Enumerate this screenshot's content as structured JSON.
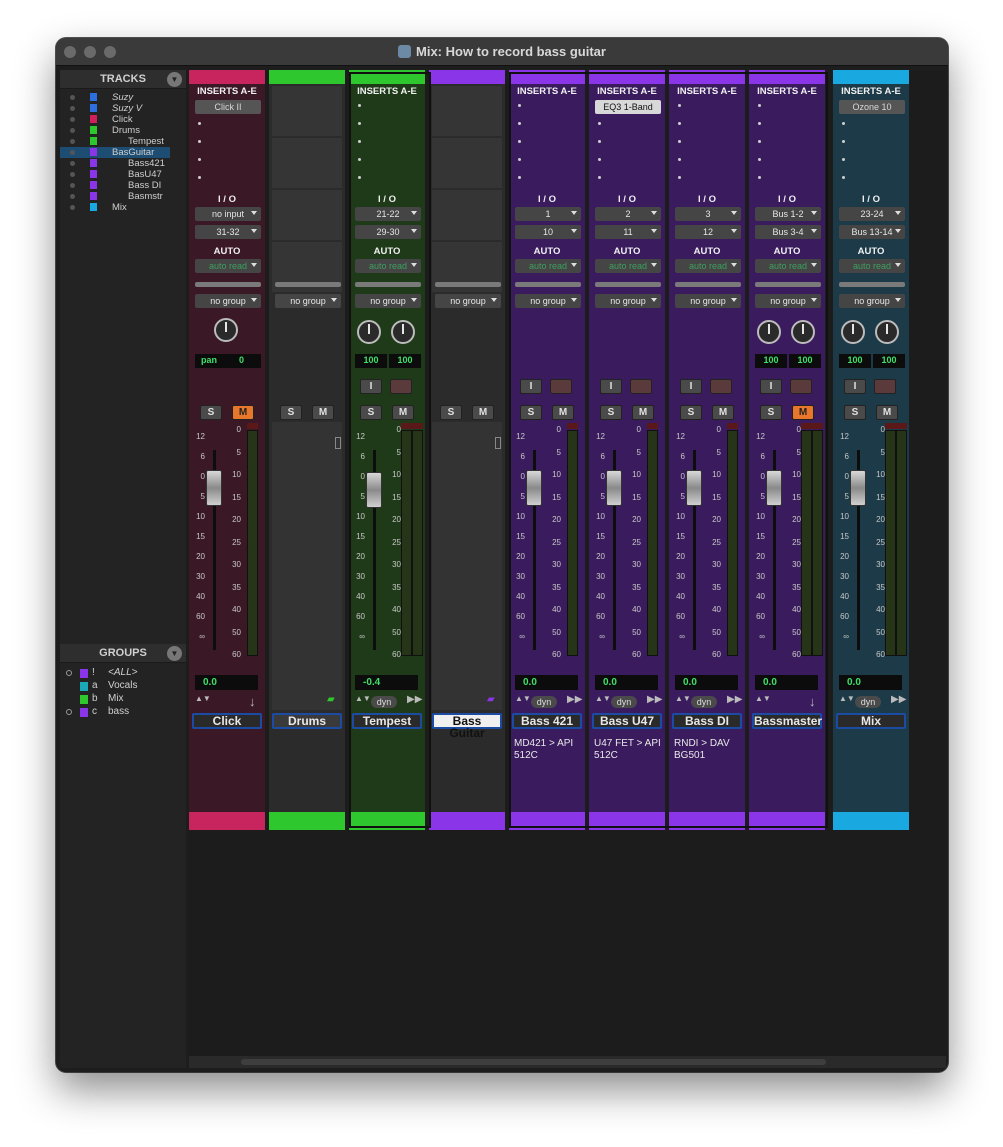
{
  "window": {
    "title": "Mix: How to record bass guitar"
  },
  "tracks_panel": {
    "header": "TRACKS",
    "items": [
      {
        "name": "Suzy",
        "color": "#2e6fe0",
        "italic": true
      },
      {
        "name": "Suzy V",
        "color": "#2e6fe0",
        "italic": true
      },
      {
        "name": "Click",
        "color": "#d0205a"
      },
      {
        "name": "Drums",
        "color": "#2ec82e"
      },
      {
        "name": "Tempest",
        "color": "#2ec82e"
      },
      {
        "name": "BasGuitar",
        "color": "#8a36e8",
        "selected": true
      },
      {
        "name": "Bass421",
        "color": "#8a36e8"
      },
      {
        "name": "BasU47",
        "color": "#8a36e8"
      },
      {
        "name": "Bass DI",
        "color": "#8a36e8"
      },
      {
        "name": "Basmstr",
        "color": "#8a36e8"
      },
      {
        "name": "Mix",
        "color": "#1aa8e0"
      }
    ]
  },
  "groups_panel": {
    "header": "GROUPS",
    "items": [
      {
        "key": "!",
        "name": "<ALL>",
        "color": "#8a36e8"
      },
      {
        "key": "a",
        "name": "Vocals",
        "color": "#1aa8b8"
      },
      {
        "key": "b",
        "name": "Mix",
        "color": "#2ec82e"
      },
      {
        "key": "c",
        "name": "bass",
        "color": "#8a36e8"
      }
    ]
  },
  "labels": {
    "inserts": "INSERTS A-E",
    "io": "I / O",
    "auto": "AUTO",
    "no_group": "no group",
    "auto_read": "auto read",
    "solo": "S",
    "mute": "M",
    "input": "I",
    "dyn": "dyn",
    "pan": "pan"
  },
  "scale_left": [
    "12",
    "6",
    "0",
    "5",
    "10",
    "15",
    "20",
    "30",
    "40",
    "60",
    "∞"
  ],
  "scale_right": [
    "0",
    "5",
    "10",
    "15",
    "20",
    "25",
    "30",
    "35",
    "40",
    "50",
    "60"
  ],
  "strips": [
    {
      "name": "Click",
      "color": "#c8245e",
      "body": "#3a1826",
      "type": "audio",
      "insert": "Click II",
      "input": "no input",
      "output": "31-32",
      "pan_value": "0",
      "volume": "0.0",
      "mute_on": true,
      "comment": ""
    },
    {
      "name": "Drums",
      "color": "#2ec82e",
      "body": "#2b2b2b",
      "type": "folder",
      "comment": ""
    },
    {
      "name": "Tempest",
      "color": "#2ec82e",
      "body": "#1f3a18",
      "type": "stereo",
      "insert": "",
      "input": "21-22",
      "output": "29-30",
      "pan_l": "100",
      "pan_r": "100",
      "volume": "-0.4",
      "mute_on": false,
      "comment": ""
    },
    {
      "name": "Bass Guitar",
      "color": "#8a36e8",
      "body": "#2b2b2b",
      "type": "folder",
      "comment": ""
    },
    {
      "name": "Bass 421",
      "color": "#8a36e8",
      "body": "#3a1c5e",
      "type": "mono",
      "insert": "",
      "input": "1",
      "output": "10",
      "volume": "0.0",
      "mute_on": false,
      "comment": "MD421 > API 512C"
    },
    {
      "name": "Bass U47",
      "color": "#8a36e8",
      "body": "#3a1c5e",
      "type": "mono",
      "insert": "EQ3 1-Band",
      "input": "2",
      "output": "11",
      "volume": "0.0",
      "mute_on": false,
      "comment": "U47 FET  >  API 512C"
    },
    {
      "name": "Bass DI",
      "color": "#8a36e8",
      "body": "#3a1c5e",
      "type": "mono",
      "insert": "",
      "input": "3",
      "output": "12",
      "volume": "0.0",
      "mute_on": false,
      "comment": "RNDI  >  DAV BG501"
    },
    {
      "name": "Bassmaster",
      "color": "#8a36e8",
      "body": "#3a1c5e",
      "type": "aux",
      "insert": "",
      "input": "Bus 1-2",
      "output": "Bus 3-4",
      "pan_l": "100",
      "pan_r": "100",
      "volume": "0.0",
      "mute_on": true,
      "comment": ""
    },
    {
      "name": "Mix",
      "color": "#1aa8e0",
      "body": "#1c3a48",
      "type": "stereo",
      "insert": "Ozone 10",
      "input": "23-24",
      "output": "Bus 13-14",
      "pan_l": "100",
      "pan_r": "100",
      "volume": "0.0",
      "mute_on": false,
      "comment": ""
    }
  ]
}
